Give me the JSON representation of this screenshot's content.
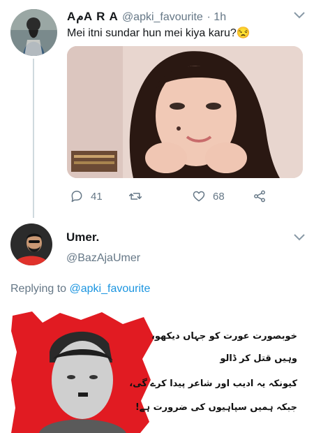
{
  "tweet1": {
    "display_name": "AمA R A",
    "handle": "@apki_favourite",
    "time": "· 1h",
    "text": "Mei itni sundar hun mei kiya karu?",
    "emoji": "😒",
    "actions": {
      "replies": "41",
      "retweets": "",
      "likes": "68"
    }
  },
  "tweet2": {
    "display_name": "Umer.",
    "handle": "@BazAjaUmer",
    "replying_prefix": "Replying to",
    "replying_handle": "@apki_favourite",
    "image_text": [
      "خوبصورت عورت کو جہاں دیکھو،",
      "وہیں قتل کر ڈالو",
      "کیونکہ یہ ادیب اور شاعر پیدا کرے گی،",
      "جبکہ ہمیں سپاہیوں کی ضرورت ہے!"
    ]
  },
  "colors": {
    "secondary": "#657786",
    "link": "#1b95e0",
    "accent_red": "#e11b22"
  },
  "icons": [
    "reply-icon",
    "retweet-icon",
    "like-icon",
    "share-icon",
    "chevron-down-icon"
  ]
}
